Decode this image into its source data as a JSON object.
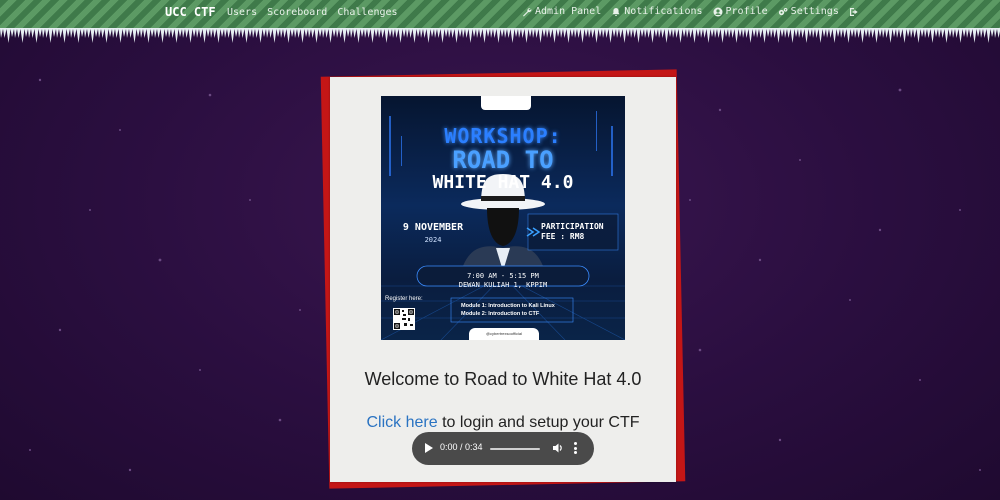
{
  "navbar": {
    "brand": "UCC CTF",
    "left_links": [
      "Users",
      "Scoreboard",
      "Challenges"
    ],
    "right_links": [
      {
        "label": "Admin Panel",
        "icon": "wrench-icon"
      },
      {
        "label": "Notifications",
        "icon": "bell-icon"
      },
      {
        "label": "Profile",
        "icon": "user-circle-icon"
      },
      {
        "label": "Settings",
        "icon": "gears-icon"
      },
      {
        "label": "",
        "icon": "logout-icon"
      }
    ]
  },
  "poster": {
    "line1": "WORKSHOP:",
    "line2": "ROAD TO",
    "line3": "WHITE HAT 4.0",
    "date": "9 NOVEMBER",
    "year": "2024",
    "fee": "PARTICIPATION FEE : RM8",
    "time": "7:00 AM - 5:15 PM",
    "venue": "DEWAN KULIAH 1, KPPIM",
    "register": "Register here:",
    "module1": "Module 1: Introduction to Kali Linux",
    "module2": "Module 2: Introduction to CTF",
    "social": "@cybertrexsoofficial"
  },
  "main": {
    "welcome": "Welcome to Road to White Hat 4.0",
    "login_link": "Click here",
    "login_rest": " to login and setup your CTF"
  },
  "audio": {
    "time": "0:00 / 0:34"
  },
  "colors": {
    "background": "#2a0e3f",
    "navbar_stripe_a": "#3f7a4a",
    "navbar_stripe_b": "#5c9a64",
    "card": "#eeeeec",
    "card_shadow": "#c41616",
    "link": "#2a73c2"
  }
}
